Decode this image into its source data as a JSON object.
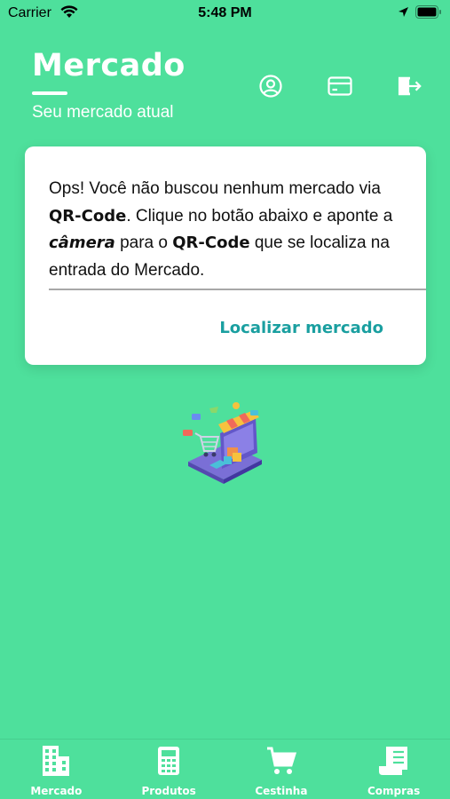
{
  "status_bar": {
    "carrier": "Carrier",
    "time": "5:48 PM"
  },
  "header": {
    "title": "Mercado",
    "subtitle": "Seu mercado atual",
    "icons": [
      "user-circle-icon",
      "credit-card-icon",
      "logout-icon"
    ]
  },
  "card": {
    "msg_1": "Ops! Você não buscou nenhum mercado via ",
    "msg_qr_1": "QR-Code",
    "msg_2": ". Clique no botão abaixo e aponte a ",
    "msg_camera": "câmera",
    "msg_3": " para o ",
    "msg_qr_2": "QR-Code",
    "msg_4": " que se localiza na entrada do Mercado.",
    "button_label": "Localizar mercado",
    "button_color": "#1a9fa0"
  },
  "tabs": [
    {
      "label": "Mercado",
      "icon": "building-icon"
    },
    {
      "label": "Produtos",
      "icon": "calculator-icon"
    },
    {
      "label": "Cestinha",
      "icon": "cart-icon"
    },
    {
      "label": "Compras",
      "icon": "receipt-icon"
    }
  ],
  "colors": {
    "background": "#4ee09c",
    "card": "#ffffff",
    "accent": "#1a9fa0"
  }
}
